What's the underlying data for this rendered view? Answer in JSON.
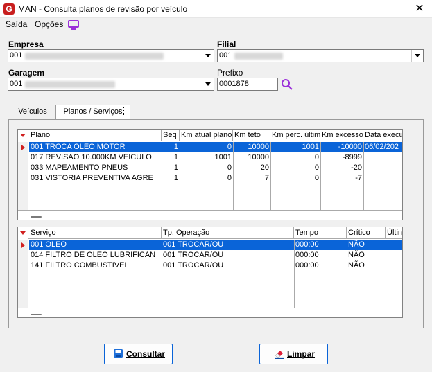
{
  "window": {
    "logo": "G",
    "title": "MAN - Consulta planos de revisão por veículo",
    "close": "✕"
  },
  "menu": {
    "saida": "Saída",
    "opcoes": "Opções"
  },
  "form": {
    "empresa": {
      "label": "Empresa",
      "value": "001"
    },
    "filial": {
      "label": "Filial",
      "value": "001"
    },
    "garagem": {
      "label": "Garagem",
      "value": "001"
    },
    "prefixo": {
      "label": "Prefixo",
      "value": "0001878"
    }
  },
  "tabs": [
    "Veículos",
    "Planos / Serviços"
  ],
  "planos": {
    "columns": [
      "Plano",
      "Seq",
      "Km atual plano",
      "Km teto",
      "Km perc. últim",
      "Km excesso",
      "Data execu"
    ],
    "rows": [
      [
        "001 TROCA OLEO MOTOR",
        "1",
        "0",
        "10000",
        "1001",
        "-10000",
        "06/02/202"
      ],
      [
        "017 REVISAO 10.000KM VEICULO",
        "1",
        "1001",
        "10000",
        "0",
        "-8999",
        ""
      ],
      [
        "033 MAPEAMENTO PNEUS",
        "1",
        "0",
        "20",
        "0",
        "-20",
        ""
      ],
      [
        "031 VISTORIA PREVENTIVA AGRE",
        "1",
        "0",
        "7",
        "0",
        "-7",
        ""
      ]
    ]
  },
  "servicos": {
    "columns": [
      "Serviço",
      "Tp. Operação",
      "Tempo",
      "Crítico",
      "Últin"
    ],
    "rows": [
      [
        "001 OLEO",
        "001 TROCAR/OU",
        "000:00",
        "NÃO",
        ""
      ],
      [
        "014 FILTRO DE OLEO LUBRIFICAN",
        "001 TROCAR/OU",
        "000:00",
        "NÃO",
        ""
      ],
      [
        "141 FILTRO COMBUSTIVEL",
        "001 TROCAR/OU",
        "000:00",
        "NÃO",
        ""
      ]
    ]
  },
  "buttons": {
    "consultar": "Consultar",
    "limpar": "Limpar"
  },
  "colors": {
    "accent": "#0a64d8",
    "brand": "#c81e1e",
    "indicator": "#d02020",
    "options_icon": "#9b30d9"
  }
}
